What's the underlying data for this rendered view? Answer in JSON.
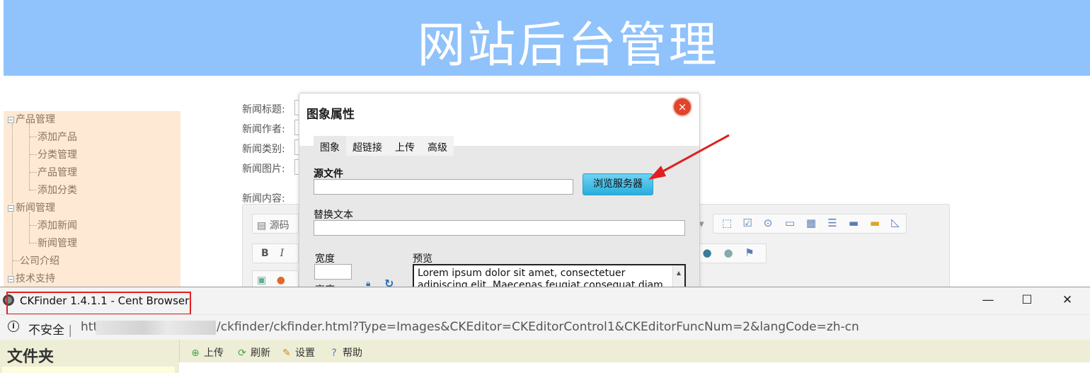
{
  "banner": {
    "title": "网站后台管理"
  },
  "sidebar": {
    "items": [
      {
        "label": "产品管理",
        "type": "group"
      },
      {
        "label": "添加产品",
        "type": "child"
      },
      {
        "label": "分类管理",
        "type": "child"
      },
      {
        "label": "产品管理",
        "type": "child"
      },
      {
        "label": "添加分类",
        "type": "child"
      },
      {
        "label": "新闻管理",
        "type": "group"
      },
      {
        "label": "添加新闻",
        "type": "child"
      },
      {
        "label": "新闻管理",
        "type": "child"
      },
      {
        "label": "公司介绍",
        "type": "leaf"
      },
      {
        "label": "技术支持",
        "type": "group"
      }
    ]
  },
  "form": {
    "title_label": "新闻标题:",
    "author_label": "新闻作者:",
    "category_label": "新闻类别:",
    "image_label": "新闻图片:",
    "content_label": "新闻内容:"
  },
  "editor": {
    "source_label": "源码",
    "bold_label": "B",
    "italic_label": "I"
  },
  "dialog": {
    "title": "图象属性",
    "close_symbol": "×",
    "tabs": [
      "图象",
      "超链接",
      "上传",
      "高级"
    ],
    "source_label": "源文件",
    "source_value": "",
    "browse_button": "浏览服务器",
    "alt_label": "替换文本",
    "alt_value": "",
    "width_label": "宽度",
    "width_value": "",
    "height_label": "高度",
    "preview_label": "预览",
    "preview_text": "Lorem ipsum dolor sit amet, consectetuer adipiscing elit. Maecenas feugiat consequat diam. Maecenas"
  },
  "popup": {
    "window_title": "CKFinder 1.4.1.1 - Cent Browser",
    "minimize": "—",
    "maximize": "☐",
    "close": "✕",
    "security_label": "不安全",
    "separator": "|",
    "url_prefix": "htt",
    "url": "/ckfinder/ckfinder.html?Type=Images&CKEditor=CKEditorControl1&CKEditorFuncNum=2&langCode=zh-cn",
    "folders_label": "文件夹",
    "toolbar": [
      {
        "label": "上传",
        "icon": "upload-icon"
      },
      {
        "label": "刷新",
        "icon": "refresh-icon"
      },
      {
        "label": "设置",
        "icon": "settings-icon"
      },
      {
        "label": "帮助",
        "icon": "help-icon"
      }
    ]
  },
  "colors": {
    "banner": "#90c2fb",
    "sidebar": "#fde9d4",
    "annotation": "#e02020",
    "browse_button": "#29aedd"
  }
}
